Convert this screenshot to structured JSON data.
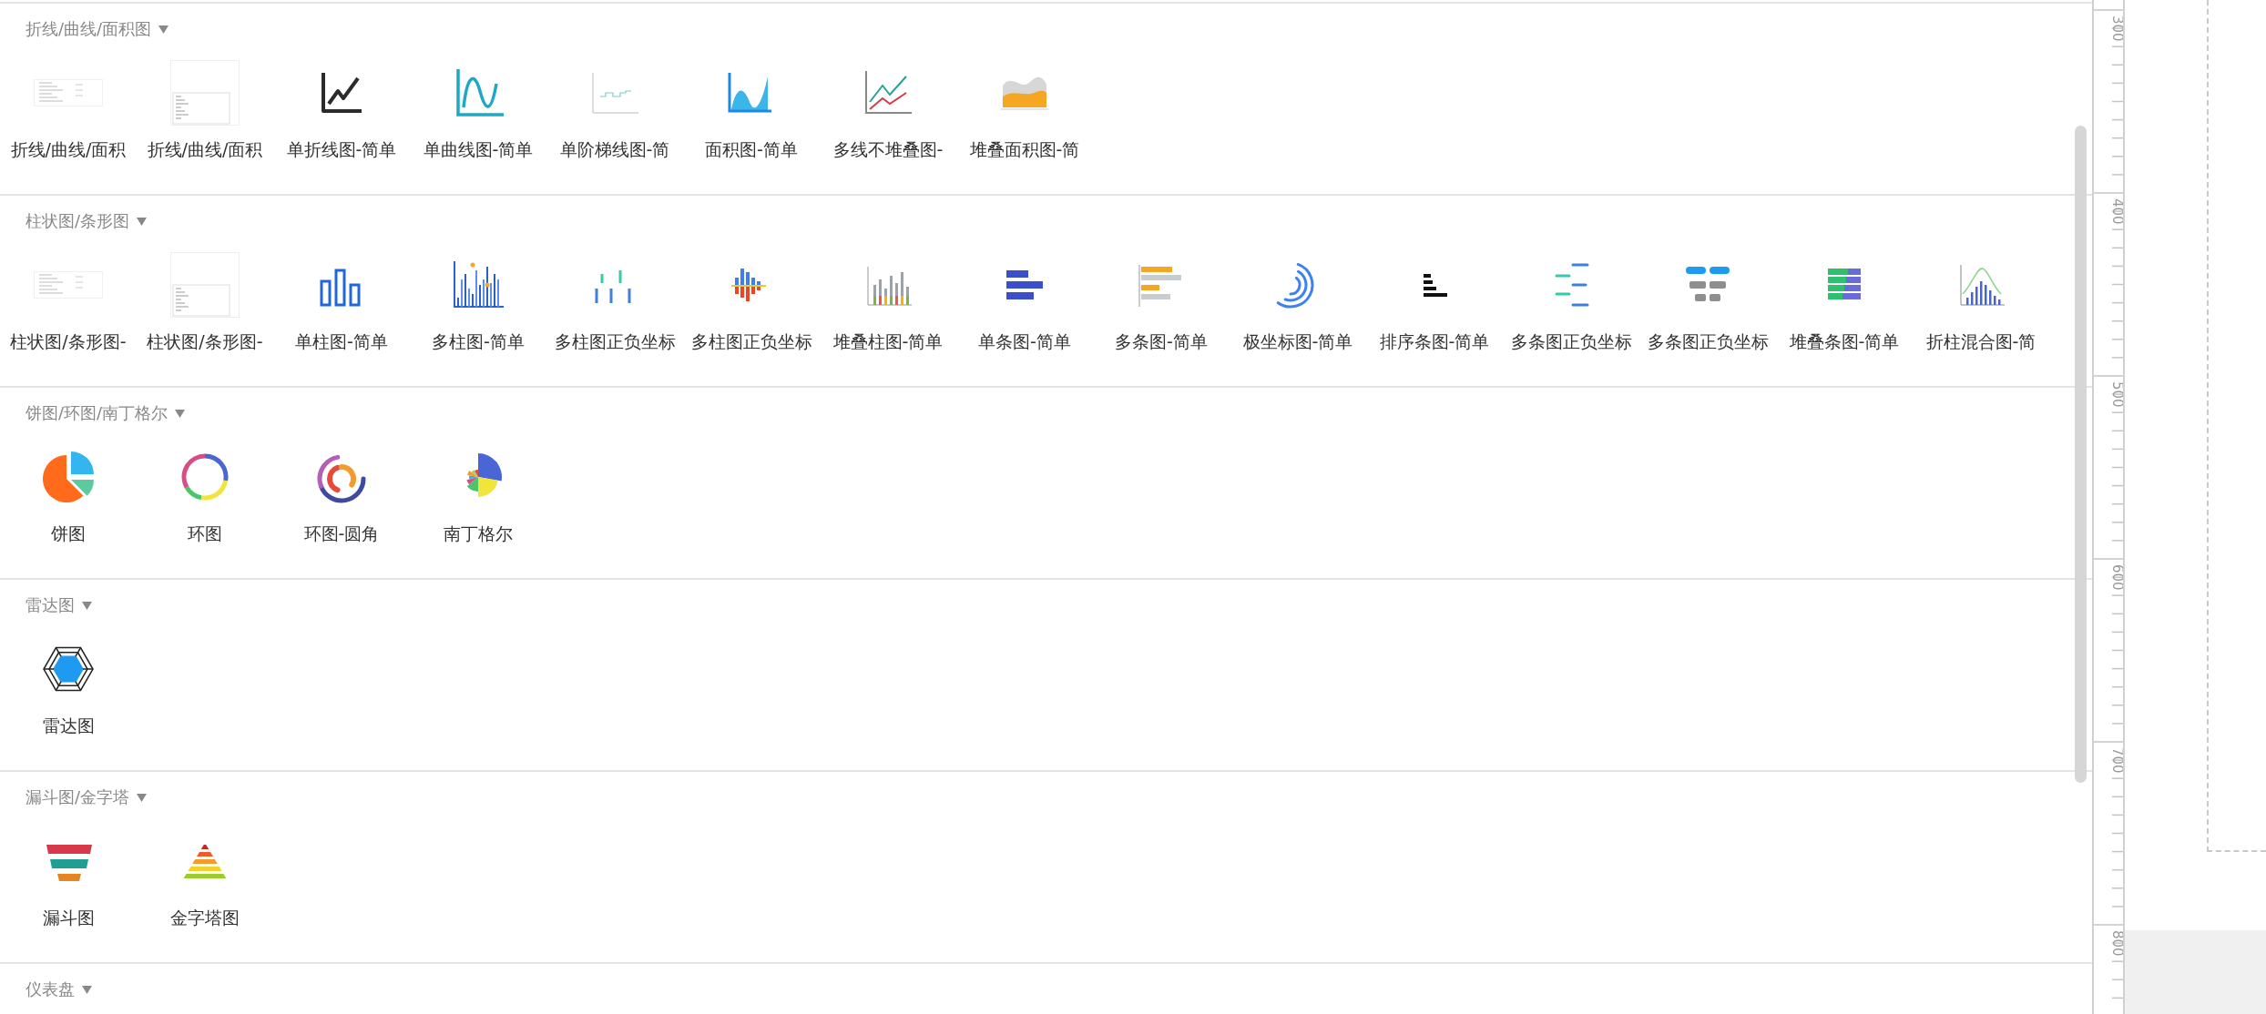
{
  "sections": [
    {
      "title": "折线/曲线/面积图",
      "expanded": true,
      "items": [
        {
          "label": "折线/曲线/面积",
          "kind": "thumbnail-wide"
        },
        {
          "label": "折线/曲线/面积",
          "kind": "thumbnail-tall"
        },
        {
          "label": "单折线图-简单",
          "kind": "line"
        },
        {
          "label": "单曲线图-简单",
          "kind": "curve"
        },
        {
          "label": "单阶梯线图-简",
          "kind": "step"
        },
        {
          "label": "面积图-简单",
          "kind": "area"
        },
        {
          "label": "多线不堆叠图-",
          "kind": "multiline"
        },
        {
          "label": "堆叠面积图-简",
          "kind": "stacked-area"
        }
      ]
    },
    {
      "title": "柱状图/条形图",
      "expanded": true,
      "items": [
        {
          "label": "柱状图/条形图-",
          "kind": "thumbnail-wide"
        },
        {
          "label": "柱状图/条形图-",
          "kind": "thumbnail-tall"
        },
        {
          "label": "单柱图-简单",
          "kind": "columns"
        },
        {
          "label": "多柱图-简单",
          "kind": "multi-columns"
        },
        {
          "label": "多柱图正负坐标",
          "kind": "posneg-columns"
        },
        {
          "label": "多柱图正负坐标",
          "kind": "posneg-columns-color"
        },
        {
          "label": "堆叠柱图-简单",
          "kind": "stacked-columns"
        },
        {
          "label": "单条图-简单",
          "kind": "hbar"
        },
        {
          "label": "多条图-简单",
          "kind": "multi-hbar"
        },
        {
          "label": "极坐标图-简单",
          "kind": "polar"
        },
        {
          "label": "排序条图-简单",
          "kind": "sorted-hbar"
        },
        {
          "label": "多条图正负坐标",
          "kind": "posneg-hbar"
        },
        {
          "label": "多条图正负坐标",
          "kind": "posneg-hbar-block"
        },
        {
          "label": "堆叠条图-简单",
          "kind": "stacked-hbar"
        },
        {
          "label": "折柱混合图-简",
          "kind": "bar-line"
        }
      ]
    },
    {
      "title": "饼图/环图/南丁格尔",
      "expanded": true,
      "items": [
        {
          "label": "饼图",
          "kind": "pie"
        },
        {
          "label": "环图",
          "kind": "donut"
        },
        {
          "label": "环图-圆角",
          "kind": "round-donut"
        },
        {
          "label": "南丁格尔",
          "kind": "rose"
        }
      ]
    },
    {
      "title": "雷达图",
      "expanded": true,
      "items": [
        {
          "label": "雷达图",
          "kind": "radar"
        }
      ]
    },
    {
      "title": "漏斗图/金字塔",
      "expanded": true,
      "items": [
        {
          "label": "漏斗图",
          "kind": "funnel"
        },
        {
          "label": "金字塔图",
          "kind": "pyramid"
        }
      ]
    },
    {
      "title": "仪表盘",
      "expanded": true
    }
  ],
  "ruler": {
    "labels": [
      "300",
      "400",
      "500",
      "600",
      "700",
      "800"
    ]
  }
}
